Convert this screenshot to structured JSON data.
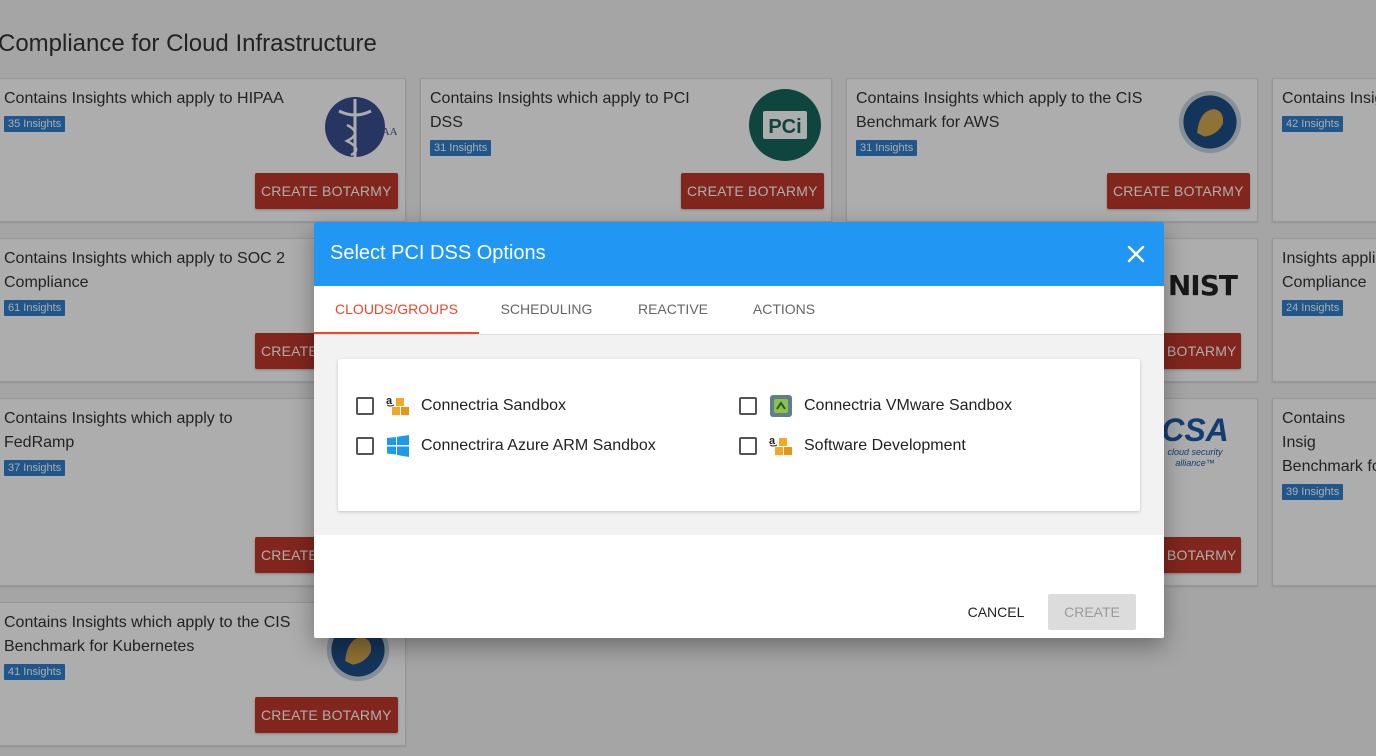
{
  "page": {
    "title": "Compliance for Cloud Infrastructure"
  },
  "cards": [
    {
      "description": "Contains Insights which apply to HIPAA",
      "insights": "35 Insights",
      "button": "CREATE BOTARMY",
      "logo": "hipaa-logo"
    },
    {
      "description": "Contains Insights which apply to PCI DSS",
      "insights": "31 Insights",
      "button": "CREATE BOTARMY",
      "logo": "pci-logo"
    },
    {
      "description": "Contains Insights which apply to the CIS Benchmark for AWS",
      "insights": "31 Insights",
      "button": "CREATE BOTARMY",
      "logo": "cis-logo"
    },
    {
      "description": "Contains Insig",
      "insights": "42 Insights"
    },
    {
      "description": "Contains Insights which apply to SOC 2 Compliance",
      "insights": "61 Insights",
      "button": "CREATE"
    },
    {
      "button": "BOTARMY",
      "logo": "nist-logo",
      "logo_text": "NIST"
    },
    {
      "description": "Insights appli Compliance",
      "insights": "24 Insights"
    },
    {
      "description": "Contains Insights which apply to FedRamp",
      "insights": "37 Insights",
      "button": "CREATE"
    },
    {
      "button": "BOTARMY",
      "logo": "csa-logo",
      "logo_text": "CSA",
      "logo_subtext": "cloud security alliance™"
    },
    {
      "description": "Contains Insig Benchmark fo",
      "insights": "39 Insights"
    },
    {
      "description": "Contains Insights which apply to the CIS Benchmark for Kubernetes",
      "insights": "41 Insights",
      "button": "CREATE BOTARMY",
      "logo": "cis-logo"
    }
  ],
  "logos": {
    "hipaa_text": "HIPAA",
    "pci_text": "PCi"
  },
  "modal": {
    "title": "Select PCI DSS Options",
    "tabs": [
      {
        "label": "CLOUDS/GROUPS",
        "active": true
      },
      {
        "label": "SCHEDULING",
        "active": false
      },
      {
        "label": "REACTIVE",
        "active": false
      },
      {
        "label": "ACTIONS",
        "active": false
      }
    ],
    "options": [
      {
        "label": "Connectria Sandbox",
        "icon": "aws-icon",
        "checked": false
      },
      {
        "label": "Connectria VMware Sandbox",
        "icon": "vmware-icon",
        "checked": false
      },
      {
        "label": "Connectrira Azure ARM Sandbox",
        "icon": "windows-azure-icon",
        "checked": false
      },
      {
        "label": "Software Development",
        "icon": "aws-icon",
        "checked": false
      }
    ],
    "cancel_label": "CANCEL",
    "create_label": "CREATE"
  },
  "colors": {
    "header_blue": "#2196f3",
    "active_tab": "#e8472b",
    "botarmy_button": "#c0392b",
    "badge": "#2f7fcf"
  }
}
